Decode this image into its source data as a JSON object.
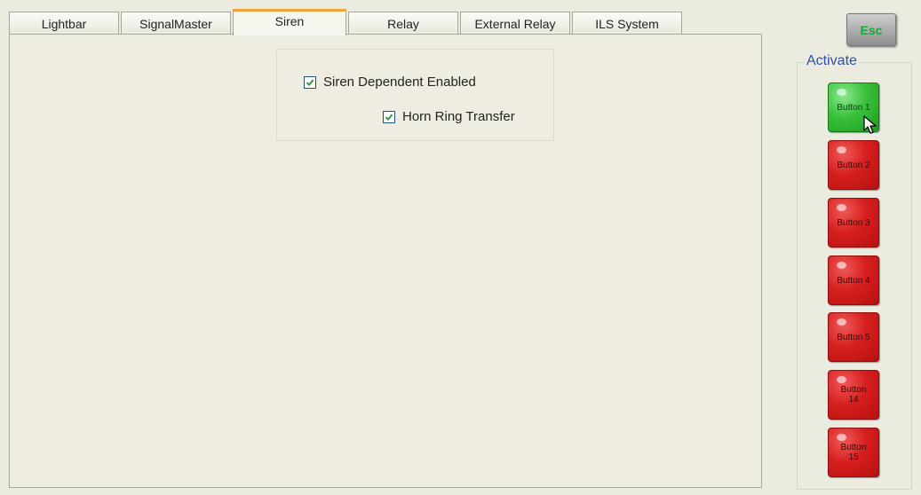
{
  "tabs": [
    {
      "label": "Lightbar",
      "active": false
    },
    {
      "label": "SignalMaster",
      "active": false
    },
    {
      "label": "Siren",
      "active": true
    },
    {
      "label": "Relay",
      "active": false
    },
    {
      "label": "External Relay",
      "active": false
    },
    {
      "label": "ILS System",
      "active": false
    }
  ],
  "siren": {
    "dependent_enabled": {
      "label": "Siren Dependent Enabled",
      "checked": true
    },
    "horn_ring_transfer": {
      "label": "Horn Ring Transfer",
      "checked": true
    }
  },
  "esc_label": "Esc",
  "activate": {
    "legend": "Activate",
    "buttons": [
      {
        "label": "Button 1",
        "state": "green"
      },
      {
        "label": "Button 2",
        "state": "red"
      },
      {
        "label": "Button 3",
        "state": "red"
      },
      {
        "label": "Button 4",
        "state": "red"
      },
      {
        "label": "Button 5",
        "state": "red"
      },
      {
        "label": "Button 14",
        "state": "red"
      },
      {
        "label": "Button 15",
        "state": "red"
      }
    ]
  },
  "colors": {
    "background": "#ecebe0",
    "active_tab_accent": "#f0a43a",
    "legend_text": "#2d4fa6",
    "esc_text": "#17a832",
    "button_active": "#39c03c",
    "button_inactive": "#d81e1e",
    "checkbox_check": "#2e9b3a"
  },
  "icons": {
    "checkbox": "checkmark-icon",
    "pointer": "mouse-cursor-icon"
  }
}
